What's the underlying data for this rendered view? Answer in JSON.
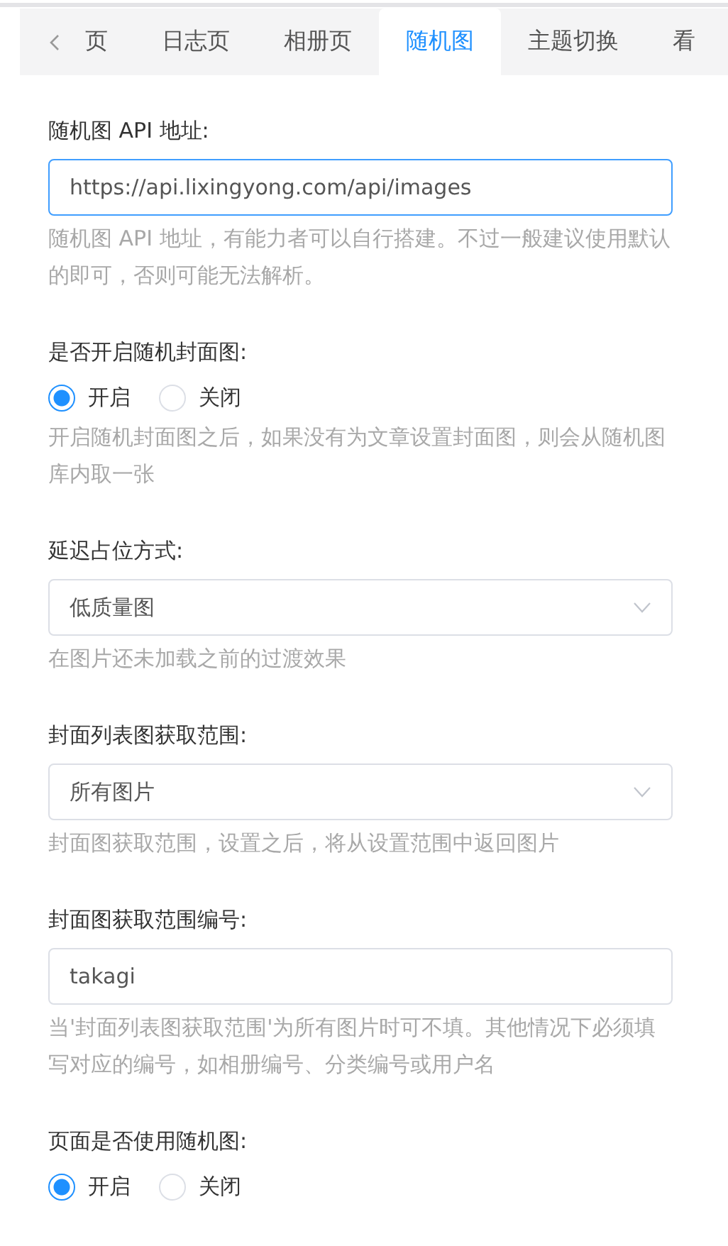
{
  "tabs": [
    {
      "label": "页",
      "selected": false
    },
    {
      "label": "日志页",
      "selected": false
    },
    {
      "label": "相册页",
      "selected": false
    },
    {
      "label": "随机图",
      "selected": true
    },
    {
      "label": "主题切换",
      "selected": false
    },
    {
      "label": "看",
      "selected": false
    }
  ],
  "fields": [
    {
      "kind": "input",
      "label": "随机图 API 地址:",
      "value": "https://api.lixingyong.com/api/images",
      "focused": true,
      "hint": "随机图 API 地址，有能力者可以自行搭建。不过一般建议使用默认的即可，否则可能无法解析。"
    },
    {
      "kind": "radio",
      "label": "是否开启随机封面图:",
      "options": [
        {
          "label": "开启",
          "selected": true
        },
        {
          "label": "关闭",
          "selected": false
        }
      ],
      "hint": "开启随机封面图之后，如果没有为文章设置封面图，则会从随机图库内取一张"
    },
    {
      "kind": "select",
      "label": "延迟占位方式:",
      "value": "低质量图",
      "hint": "在图片还未加载之前的过渡效果"
    },
    {
      "kind": "select",
      "label": "封面列表图获取范围:",
      "value": "所有图片",
      "hint": "封面图获取范围，设置之后，将从设置范围中返回图片"
    },
    {
      "kind": "input",
      "label": "封面图获取范围编号:",
      "value": "takagi",
      "focused": false,
      "hint": "当'封面列表图获取范围'为所有图片时可不填。其他情况下必须填写对应的编号，如相册编号、分类编号或用户名"
    },
    {
      "kind": "radio",
      "label": "页面是否使用随机图:",
      "options": [
        {
          "label": "开启",
          "selected": true
        },
        {
          "label": "关闭",
          "selected": false
        }
      ]
    }
  ]
}
